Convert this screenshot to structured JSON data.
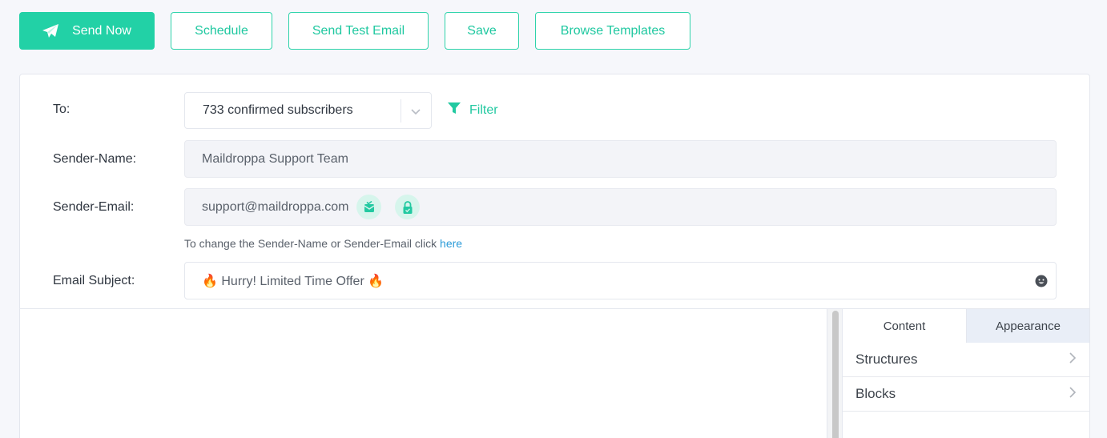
{
  "toolbar": {
    "send_now": "Send Now",
    "schedule": "Schedule",
    "send_test": "Send Test Email",
    "save": "Save",
    "browse_templates": "Browse Templates"
  },
  "form": {
    "to_label": "To:",
    "to_value": "733 confirmed subscribers",
    "filter_label": "Filter",
    "sender_name_label": "Sender-Name:",
    "sender_name_value": "Maildroppa Support Team",
    "sender_email_label": "Sender-Email:",
    "sender_email_value": "support@maildroppa.com",
    "hint_text": "To change the Sender-Name or Sender-Email click ",
    "hint_link": "here",
    "subject_label": "Email Subject:",
    "subject_value": "🔥 Hurry! Limited Time Offer 🔥"
  },
  "side_panel": {
    "tabs": [
      {
        "label": "Content",
        "active": true
      },
      {
        "label": "Appearance",
        "active": false
      }
    ],
    "items": [
      {
        "label": "Structures"
      },
      {
        "label": "Blocks"
      }
    ]
  },
  "colors": {
    "accent": "#22d1a6",
    "link": "#2b9bd8",
    "tab_inactive_bg": "#e9eef7"
  }
}
